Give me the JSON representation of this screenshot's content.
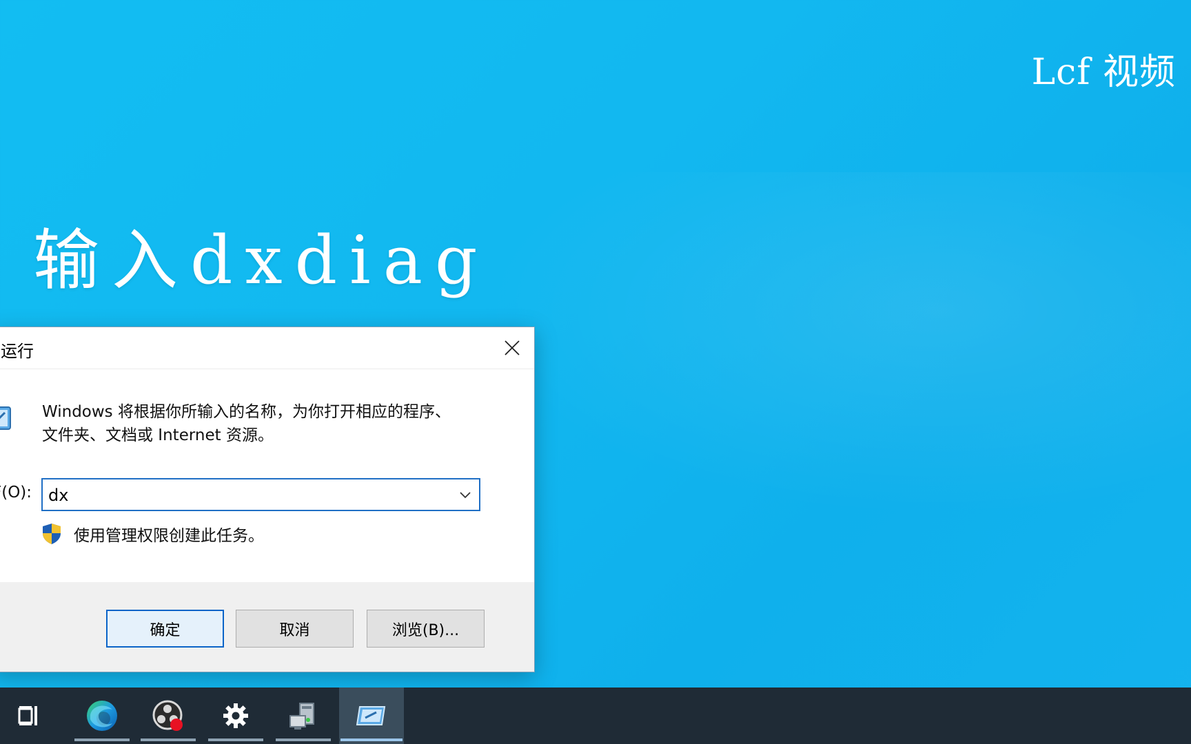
{
  "desktop": {
    "watermark": "Lcf 视频",
    "caption": "输入dxdiag"
  },
  "run_dialog": {
    "title": "运行",
    "description_line1": "Windows 将根据你所输入的名称，为你打开相应的程序、",
    "description_line2": "文件夹、文档或 Internet 资源。",
    "open_label": "打开(O):",
    "open_label_visible": "F(O):",
    "input_value": "dx",
    "admin_text": "使用管理权限创建此任务。",
    "buttons": {
      "ok": "确定",
      "cancel": "取消",
      "browse": "浏览(B)..."
    }
  },
  "taskbar": {
    "items": [
      {
        "name": "task-view",
        "icon": "task-view-icon"
      },
      {
        "name": "edge",
        "icon": "edge-icon"
      },
      {
        "name": "obs",
        "icon": "obs-icon"
      },
      {
        "name": "settings",
        "icon": "gear-icon"
      },
      {
        "name": "device-manager",
        "icon": "device-icon"
      },
      {
        "name": "run",
        "icon": "run-icon"
      }
    ]
  },
  "colors": {
    "desktop": "#12bdf2",
    "taskbar": "#1f2b36",
    "accent": "#1f6fc5"
  }
}
